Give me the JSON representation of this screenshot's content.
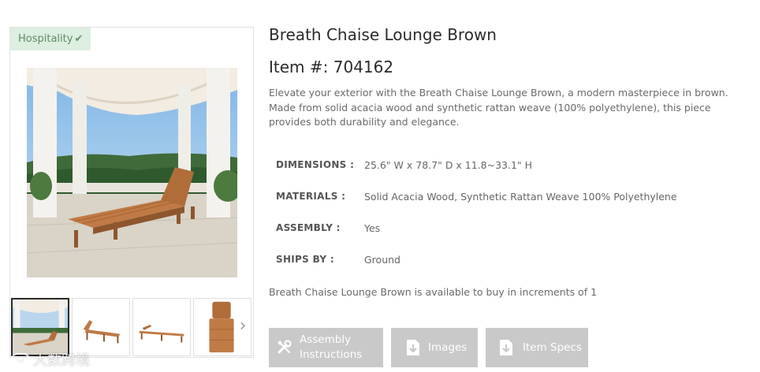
{
  "gallery": {
    "badge_label": "Hospitality",
    "badge_icon": "check-icon",
    "main_image_alt": "Breath Chaise Lounge Brown",
    "thumbnails": [
      {
        "view": "patio"
      },
      {
        "view": "side-reclined"
      },
      {
        "view": "side-flat"
      },
      {
        "view": "top"
      }
    ],
    "next_icon": "chevron-right-icon"
  },
  "product": {
    "title": "Breath Chaise Lounge Brown",
    "item_number": "Item #: 704162",
    "description": "Elevate your exterior with the Breath Chaise Lounge Brown, a modern masterpiece in brown. Made from solid acacia wood and synthetic rattan weave (100% polyethylene), this piece provides both durability and elegance.",
    "specs": [
      {
        "key": "DIMENSIONS :",
        "value": "25.6\" W x 78.7\" D x 11.8~33.1\" H"
      },
      {
        "key": "MATERIALS :",
        "value": "Solid Acacia Wood, Synthetic Rattan Weave 100% Polyethylene"
      },
      {
        "key": "ASSEMBLY :",
        "value": "Yes"
      },
      {
        "key": "SHIPS BY :",
        "value": "Ground"
      }
    ],
    "availability": "Breath Chaise Lounge Brown is available to buy in increments of 1"
  },
  "actions": [
    {
      "label": "Assembly Instructions",
      "line1": "Assembly",
      "line2": "Instructions",
      "icon": "wrench-screwdriver-icon"
    },
    {
      "label": "Images",
      "icon": "download-icon"
    },
    {
      "label": "Item Specs",
      "icon": "download-icon"
    }
  ],
  "watermark": {
    "text": "大数跨境"
  },
  "colors": {
    "badge_bg": "#dcefe0",
    "badge_text": "#5f8a68",
    "button_bg": "#c9c9c9",
    "button_text": "#ffffff",
    "wood": "#c07a45"
  }
}
